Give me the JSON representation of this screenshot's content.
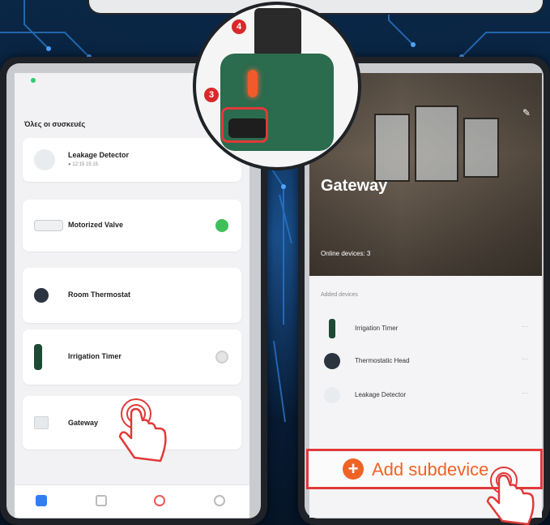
{
  "left_screen": {
    "title": "Όλες οι συσκευές",
    "devices": [
      {
        "name": "Leakage Detector",
        "sub": "● 12:15 15:15",
        "icon": "leakage-detector-icon"
      },
      {
        "name": "Motorized Valve",
        "sub": "",
        "icon": "motorized-valve-icon",
        "toggle": "on"
      },
      {
        "name": "Room Thermostat",
        "sub": "",
        "icon": "room-thermostat-icon"
      },
      {
        "name": "Irrigation Timer",
        "sub": "",
        "icon": "irrigation-timer-icon",
        "toggle": "off"
      },
      {
        "name": "Gateway",
        "sub": "",
        "icon": "gateway-icon"
      }
    ],
    "tabs": [
      "home-icon",
      "scene-icon",
      "smart-icon",
      "profile-icon"
    ]
  },
  "right_screen": {
    "hero_title": "Gateway",
    "online_devices": "Online devices: 3",
    "added_label": "Added devices",
    "subdevices": [
      {
        "name": "Irrigation Timer",
        "icon": "irrigation-timer-icon",
        "more": "···"
      },
      {
        "name": "Thermostatic Head",
        "icon": "thermostatic-head-icon",
        "more": "···"
      },
      {
        "name": "Leakage Detector",
        "icon": "leakage-detector-icon",
        "more": "···"
      }
    ],
    "add_button": "Add subdevice",
    "add_plus": "+"
  },
  "callout": {
    "step_top": "4",
    "step_bottom": "3"
  },
  "colors": {
    "accent": "#f06327",
    "highlight": "#e03a3a",
    "toggle_on": "#3fbf5a",
    "valve_green": "#2b6b4e"
  }
}
